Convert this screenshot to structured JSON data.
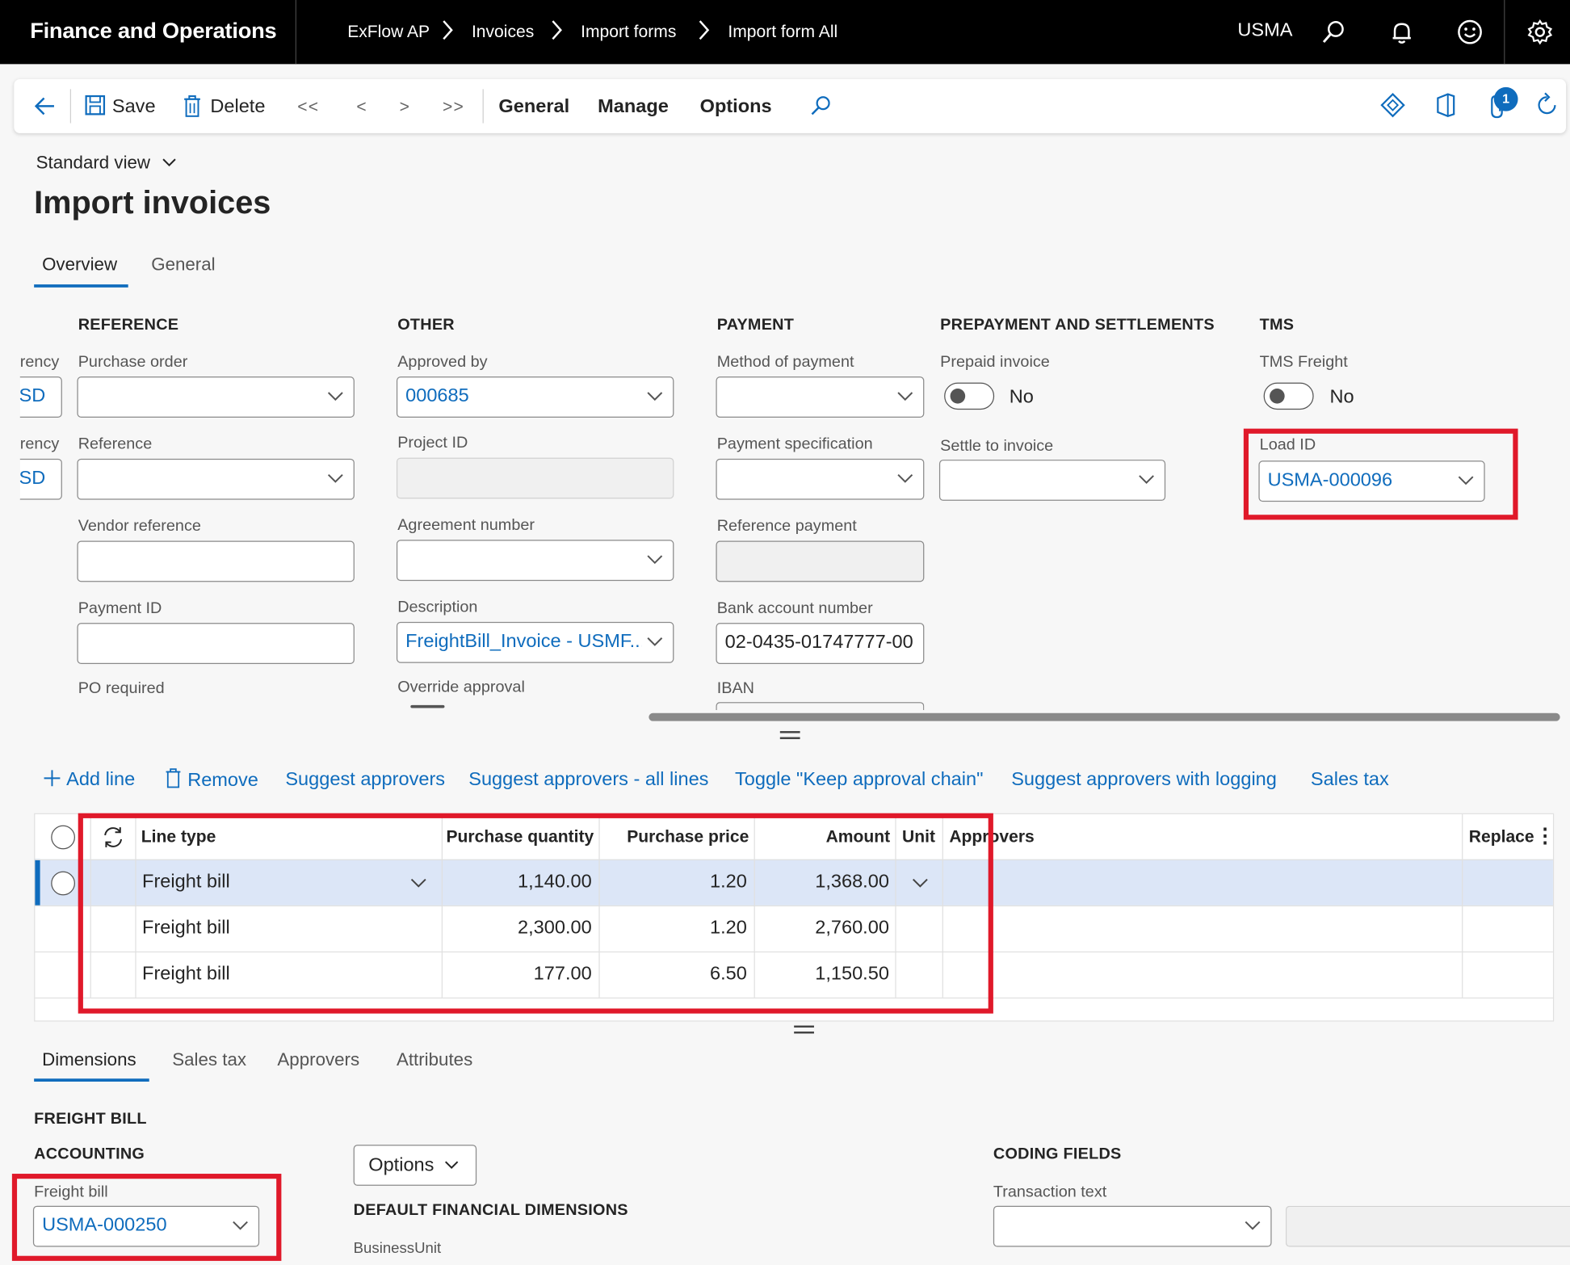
{
  "topbar": {
    "app_title": "Finance and Operations",
    "breadcrumbs": [
      "ExFlow AP",
      "Invoices",
      "Import forms",
      "Import form All"
    ],
    "company": "USMA",
    "icons": [
      "search-icon",
      "bell-icon",
      "smiley-icon",
      "gear-icon"
    ]
  },
  "actionbar": {
    "save": "Save",
    "delete": "Delete",
    "first": "<<",
    "prev": "<",
    "next": ">",
    "last": ">>",
    "menus": [
      "General",
      "Manage",
      "Options"
    ],
    "badge_count": "1"
  },
  "page": {
    "view": "Standard view",
    "title": "Import invoices",
    "tabs": [
      "Overview",
      "General"
    ]
  },
  "overview": {
    "partial_label_1": "rency",
    "partial_value_1": "SD",
    "partial_label_2": "rency",
    "partial_value_2": "SD",
    "reference": {
      "heading": "REFERENCE",
      "purchase_order_label": "Purchase order",
      "reference_label": "Reference",
      "vendor_reference_label": "Vendor reference",
      "payment_id_label": "Payment ID",
      "po_required_label": "PO required"
    },
    "other": {
      "heading": "OTHER",
      "approved_by_label": "Approved by",
      "approved_by_value": "000685",
      "project_id_label": "Project ID",
      "agreement_number_label": "Agreement number",
      "description_label": "Description",
      "description_value": "FreightBill_Invoice - USMF...",
      "override_approval_label": "Override approval"
    },
    "payment": {
      "heading": "PAYMENT",
      "method_label": "Method of payment",
      "spec_label": "Payment specification",
      "ref_payment_label": "Reference payment",
      "bank_account_label": "Bank account number",
      "bank_account_value": "02-0435-01747777-00",
      "iban_label": "IBAN"
    },
    "prepayment": {
      "heading": "PREPAYMENT AND SETTLEMENTS",
      "prepaid_label": "Prepaid invoice",
      "prepaid_value": "No",
      "settle_label": "Settle to invoice"
    },
    "tms": {
      "heading": "TMS",
      "freight_label": "TMS Freight",
      "freight_value": "No",
      "load_id_label": "Load ID",
      "load_id_value": "USMA-000096"
    }
  },
  "line_actions": [
    "Add line",
    "Remove",
    "Suggest approvers",
    "Suggest approvers - all lines",
    "Toggle \"Keep approval chain\"",
    "Suggest approvers with logging",
    "Sales tax"
  ],
  "grid": {
    "columns": [
      "Line type",
      "Purchase quantity",
      "Purchase price",
      "Amount",
      "Unit",
      "Approvers",
      "Replace"
    ],
    "rows": [
      {
        "line_type": "Freight bill",
        "qty": "1,140.00",
        "price": "1.20",
        "amount": "1,368.00",
        "selected": true
      },
      {
        "line_type": "Freight bill",
        "qty": "2,300.00",
        "price": "1.20",
        "amount": "2,760.00",
        "selected": false
      },
      {
        "line_type": "Freight bill",
        "qty": "177.00",
        "price": "6.50",
        "amount": "1,150.50",
        "selected": false
      }
    ]
  },
  "details": {
    "tabs": [
      "Dimensions",
      "Sales tax",
      "Approvers",
      "Attributes"
    ],
    "freight_bill_heading": "FREIGHT BILL",
    "accounting_heading": "ACCOUNTING",
    "freight_bill_label": "Freight bill",
    "freight_bill_value": "USMA-000250",
    "options_label": "Options",
    "default_dims_heading": "DEFAULT FINANCIAL DIMENSIONS",
    "business_unit_label": "BusinessUnit",
    "coding_fields_heading": "CODING FIELDS",
    "transaction_text_label": "Transaction text"
  }
}
